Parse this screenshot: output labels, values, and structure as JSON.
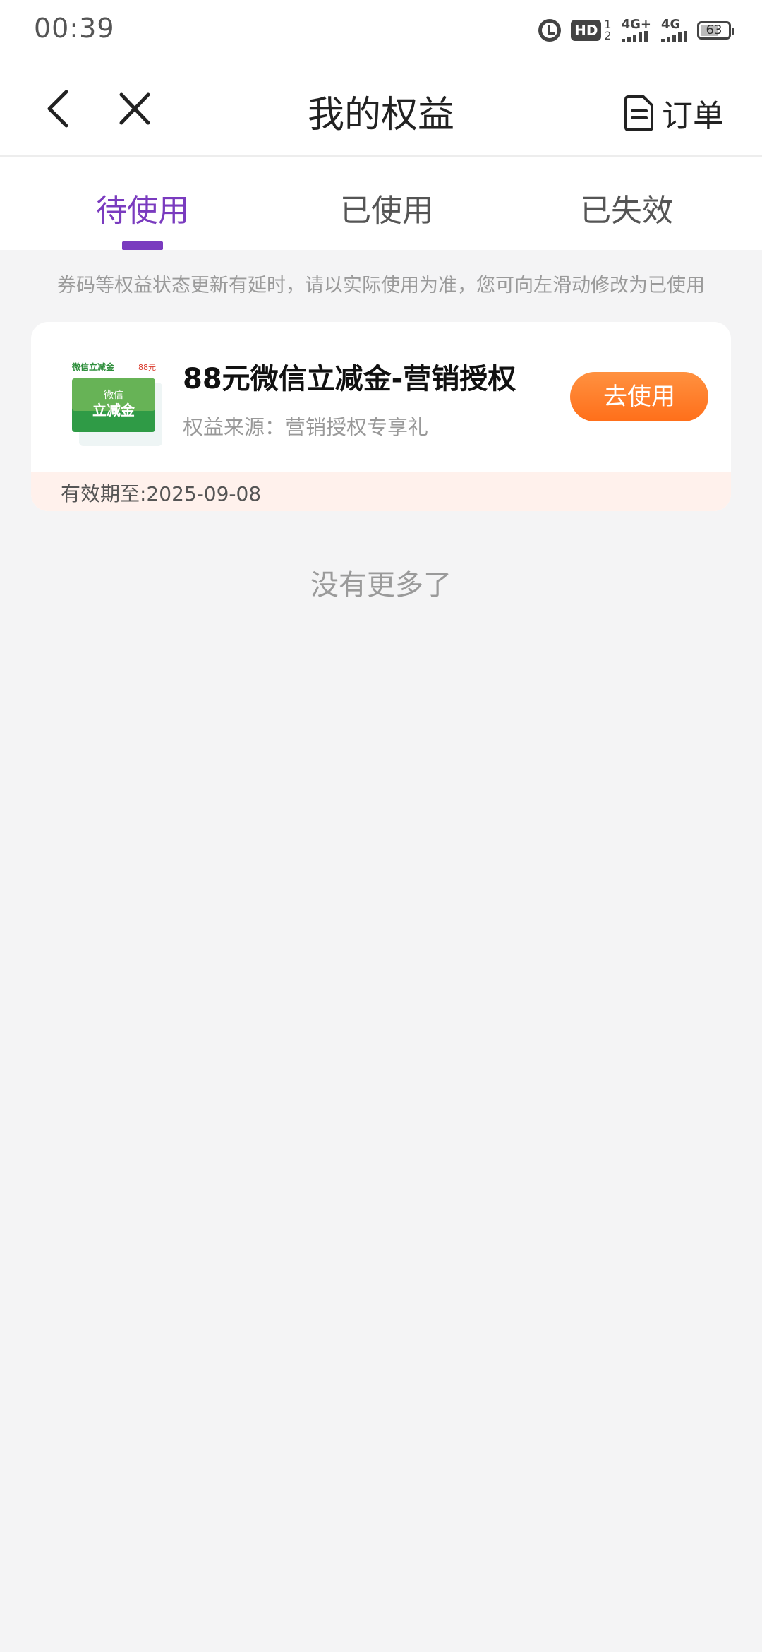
{
  "status_bar": {
    "time": "00:39",
    "hd_label": "HD",
    "sim_primary": "1",
    "sim_secondary": "2",
    "network1_label": "4G+",
    "network2_label": "4G",
    "battery_level": "63",
    "battery_percent": 63
  },
  "nav": {
    "title": "我的权益",
    "orders_label": "订单",
    "back_icon": "chevron-left-icon",
    "close_icon": "close-icon",
    "orders_icon": "document-icon"
  },
  "tabs": [
    {
      "label": "待使用",
      "active": true
    },
    {
      "label": "已使用",
      "active": false
    },
    {
      "label": "已失效",
      "active": false
    }
  ],
  "notice": "券码等权益状态更新有延时，请以实际使用为准，您可向左滑动修改为已使用",
  "cards": [
    {
      "title": "88元微信立减金-营销授权",
      "source": "权益来源：营销授权专享礼",
      "button_label": "去使用",
      "validity": "有效期至:2025-09-08",
      "thumb_top_left": "微信立减金",
      "thumb_top_right": "88元",
      "thumb_line1": "微信",
      "thumb_line2": "立减金"
    }
  ],
  "end_text": "没有更多了",
  "colors": {
    "accent": "#7a3bbf",
    "button": "#ff7a26",
    "background": "#f4f4f5",
    "card_footer": "#fff1ec"
  }
}
